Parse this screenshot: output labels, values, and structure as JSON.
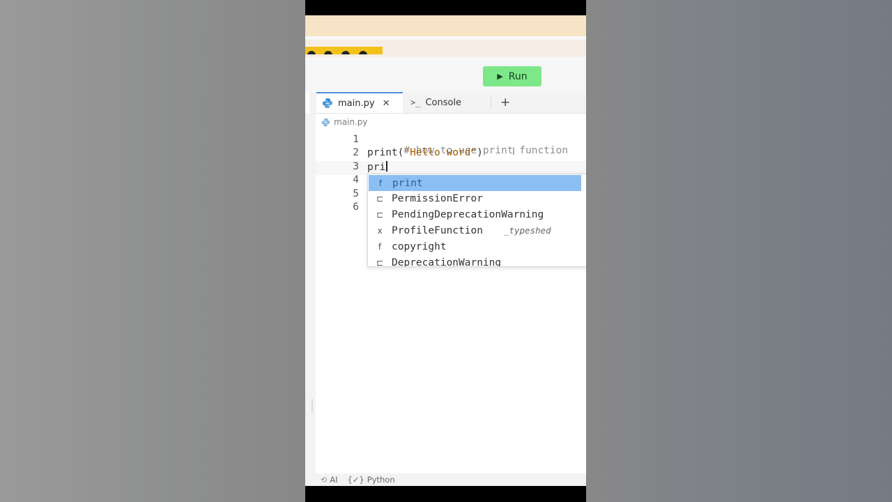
{
  "toolbar": {
    "run_label": "Run"
  },
  "tabs": [
    {
      "label": "main.py",
      "close": "✕",
      "icon": "python-icon"
    },
    {
      "label": "Console",
      "icon": "console-prompt-icon",
      "icon_text": ">_"
    }
  ],
  "add_tab": "+",
  "breadcrumb": {
    "file": "main.py"
  },
  "editor": {
    "line_numbers": [
      "1",
      "2",
      "3",
      "4",
      "5",
      "6"
    ],
    "lines": {
      "l1": "# how to use print function",
      "l2_fn": "print(",
      "l2_str": "\"Hello word\"",
      "l2_end": ")",
      "l3": "pri"
    }
  },
  "autocomplete": {
    "items": [
      {
        "kind": "f",
        "label": "print",
        "detail": ""
      },
      {
        "kind": "⊏",
        "label": "PermissionError",
        "detail": ""
      },
      {
        "kind": "⊏",
        "label": "PendingDeprecationWarning",
        "detail": ""
      },
      {
        "kind": "x",
        "label": "ProfileFunction",
        "detail": "_typeshed"
      },
      {
        "kind": "f",
        "label": "copyright",
        "detail": ""
      },
      {
        "kind": "⊏",
        "label": "DeprecationWarning",
        "detail": ""
      }
    ]
  },
  "status_bar": {
    "ai": "AI",
    "language_icon_text": "{✓}",
    "language": "Python"
  },
  "colors": {
    "run_button": "#7ce889",
    "selection": "#8bbff4",
    "active_tab_border": "#4a8de0"
  }
}
